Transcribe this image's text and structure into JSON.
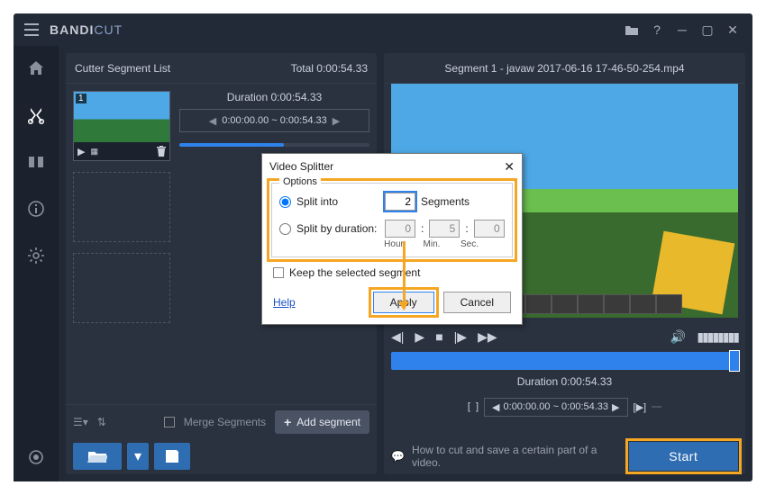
{
  "app": {
    "brand": "BANDI",
    "brand_suffix": "CUT"
  },
  "left": {
    "title": "Cutter Segment List",
    "total_label": "Total 0:00:54.33",
    "duration_label": "Duration 0:00:54.33",
    "range": "0:00:00.00 ~ 0:00:54.33",
    "merge_label": "Merge Segments",
    "add_segment": "Add segment",
    "thumb_index": "1"
  },
  "right": {
    "title": "Segment 1 - javaw 2017-06-16 17-46-50-254.mp4",
    "duration_label": "Duration 0:00:54.33",
    "range": "0:00:00.00 ~ 0:00:54.33",
    "hint": "How to cut and save a certain part of a video.",
    "start": "Start"
  },
  "dialog": {
    "title": "Video Splitter",
    "options_legend": "Options",
    "split_into": "Split into",
    "segments_label": "Segments",
    "segments_value": "2",
    "split_by_duration": "Split by duration:",
    "hour_value": "0",
    "min_value": "5",
    "sec_value": "0",
    "hour_label": "Hour",
    "min_label": "Min.",
    "sec_label": "Sec.",
    "keep_selected": "Keep the selected segment",
    "help": "Help",
    "apply": "Apply",
    "cancel": "Cancel"
  }
}
